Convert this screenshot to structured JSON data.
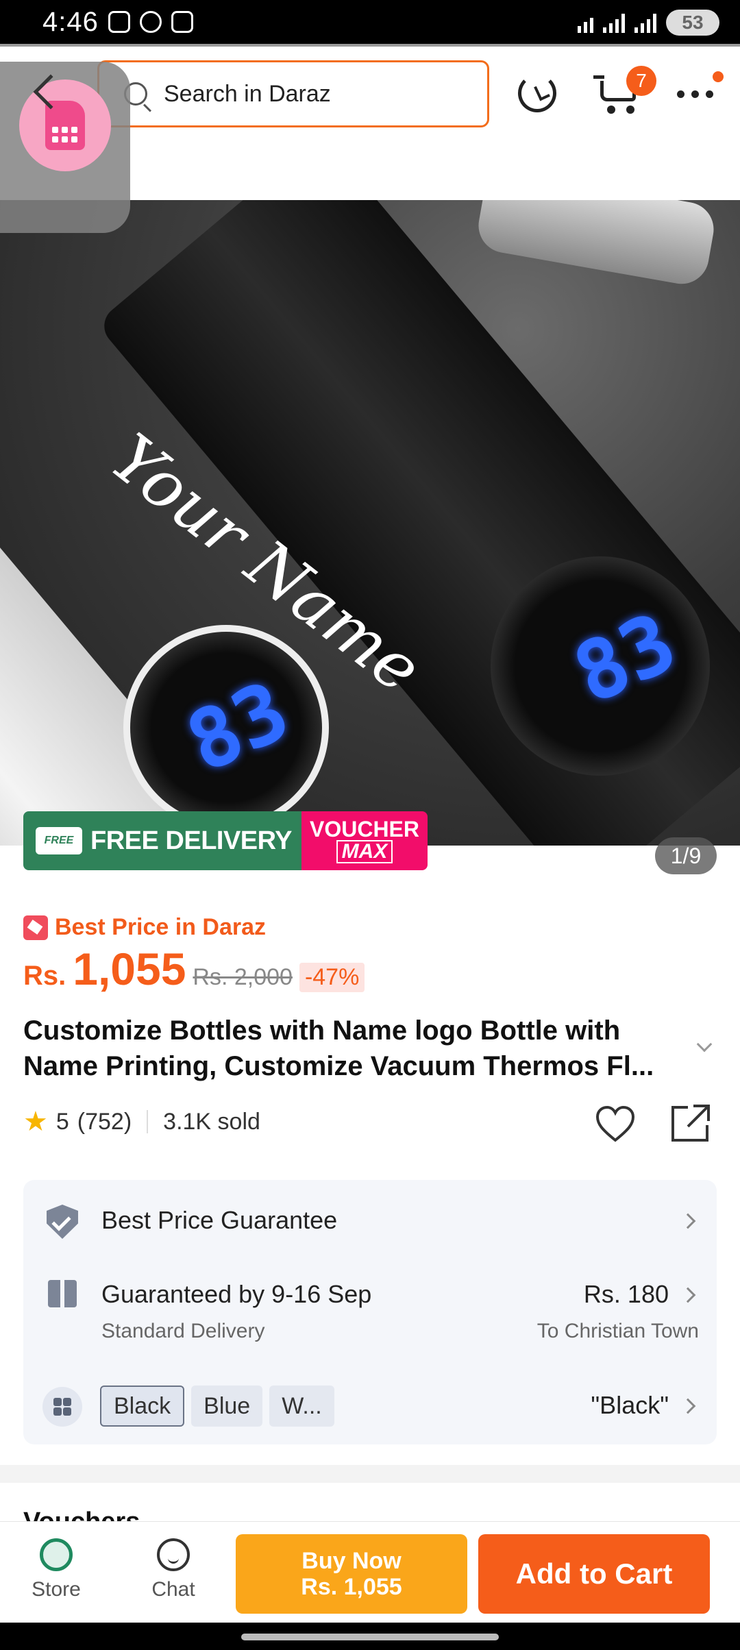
{
  "status_bar": {
    "time": "4:46",
    "battery": "53"
  },
  "header": {
    "search_placeholder": "Search in Daraz",
    "cart_count": "7",
    "icons": [
      "back-arrow-icon",
      "search-icon",
      "refresh-icon",
      "cart-icon",
      "more-icon",
      "sim-card-icon"
    ]
  },
  "gallery": {
    "engraving": "Your Name",
    "display_reading": "83",
    "promo_free_delivery": "FREE DELIVERY",
    "promo_truck_tag": "FREE",
    "promo_voucher_top": "VOUCHER",
    "promo_voucher_bottom": "MAX",
    "counter": "1/9"
  },
  "product": {
    "best_price_label": "Best Price in Daraz",
    "currency": "Rs.",
    "price": "1,055",
    "old_price": "Rs. 2,000",
    "discount": "-47%",
    "title": "Customize Bottles with Name logo Bottle with Name Printing, Customize Vacuum Thermos Fl...",
    "rating": "5",
    "reviews": "(752)",
    "sold": "3.1K sold"
  },
  "info_card": {
    "guarantee": "Best Price Guarantee",
    "delivery_date": "Guaranteed by 9-16 Sep",
    "delivery_type": "Standard Delivery",
    "delivery_fee": "Rs. 180",
    "delivery_to": "To Christian Town",
    "variants": [
      "Black",
      "Blue",
      "W..."
    ],
    "selected_variant": "\"Black\""
  },
  "sections": {
    "vouchers": "Vouchers"
  },
  "bottom_bar": {
    "store": "Store",
    "chat": "Chat",
    "buy_now": "Buy Now",
    "buy_now_price": "Rs. 1,055",
    "add_to_cart": "Add to Cart"
  },
  "colors": {
    "accent": "#f55d1a",
    "buy_now": "#faa61a",
    "free_delivery": "#2f8259",
    "voucher_max": "#f20d6a"
  }
}
